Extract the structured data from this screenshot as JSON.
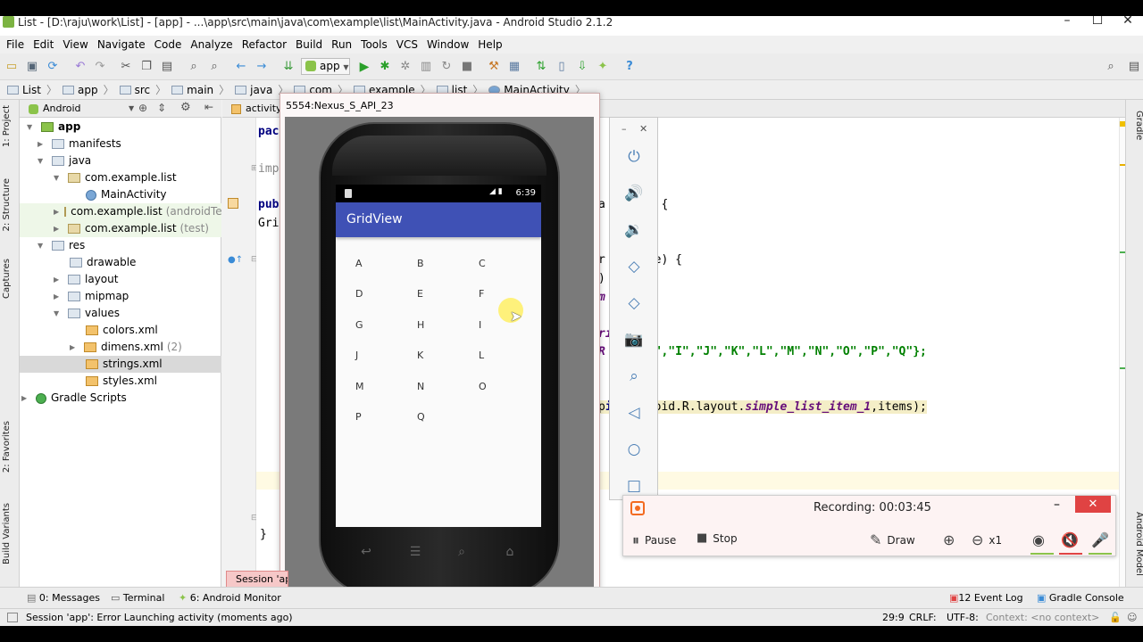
{
  "window": {
    "title": "List - [D:\\raju\\work\\List] - [app] - ...\\app\\src\\main\\java\\com\\example\\list\\MainActivity.java - Android Studio 2.1.2"
  },
  "menu": [
    "File",
    "Edit",
    "View",
    "Navigate",
    "Code",
    "Analyze",
    "Refactor",
    "Build",
    "Run",
    "Tools",
    "VCS",
    "Window",
    "Help"
  ],
  "toolbar": {
    "run_config": "app"
  },
  "breadcrumb": [
    "List",
    "app",
    "src",
    "main",
    "java",
    "com",
    "example",
    "list",
    "MainActivity"
  ],
  "left_tabs": [
    "1: Project",
    "2: Structure",
    "Captures",
    "2: Favorites",
    "Build Variants"
  ],
  "right_tabs": [
    "Gradle",
    "Android Model"
  ],
  "project_panel": {
    "view_selector": "Android",
    "tree": [
      {
        "label": "app",
        "extra": ""
      },
      {
        "label": "manifests",
        "extra": ""
      },
      {
        "label": "java",
        "extra": ""
      },
      {
        "label": "com.example.list",
        "extra": ""
      },
      {
        "label": "MainActivity",
        "extra": ""
      },
      {
        "label": "com.example.list",
        "extra": "(androidTest)"
      },
      {
        "label": "com.example.list",
        "extra": "(test)"
      },
      {
        "label": "res",
        "extra": ""
      },
      {
        "label": "drawable",
        "extra": ""
      },
      {
        "label": "layout",
        "extra": ""
      },
      {
        "label": "mipmap",
        "extra": ""
      },
      {
        "label": "values",
        "extra": ""
      },
      {
        "label": "colors.xml",
        "extra": ""
      },
      {
        "label": "dimens.xml",
        "extra": "(2)"
      },
      {
        "label": "strings.xml",
        "extra": ""
      },
      {
        "label": "styles.xml",
        "extra": ""
      },
      {
        "label": "Gradle Scripts",
        "extra": ""
      }
    ]
  },
  "editor": {
    "tab": "activity_",
    "lines": {
      "l1": "pac",
      "l2": "imp",
      "l3": "pub",
      "l4": "Gri",
      "l5a": "a",
      "l5b": "ivity {",
      "l6a": "r",
      "l6b": "eState) {",
      "l7": ")",
      "l8": "m",
      "l9a": "ri",
      "l9b": ";",
      "l10a": "R",
      "l10b": "\"G\",\"H\",\"I\",\"J\",\"K\",\"L\",\"M\",\"N\",\"O\",\"P\",\"Q\"};",
      "l11a": "p",
      "l11b": "is",
      "l11c": ",android.R.layout.",
      "l11d": "simple_list_item_1",
      "l11e": ",items);",
      "l12": "}"
    }
  },
  "emulator": {
    "title": "5554:Nexus_S_API_23",
    "time": "6:39",
    "app_title": "GridView",
    "grid": [
      "A",
      "B",
      "C",
      "D",
      "E",
      "F",
      "G",
      "H",
      "I",
      "J",
      "K",
      "L",
      "M",
      "N",
      "O",
      "P",
      "Q"
    ]
  },
  "recording": {
    "label": "Recording:",
    "time": "00:03:45",
    "pause": "Pause",
    "stop": "Stop",
    "draw": "Draw",
    "zoom": "x1"
  },
  "bottom_tabs": {
    "messages": "0: Messages",
    "terminal": "Terminal",
    "monitor": "6: Android Monitor",
    "event_log": "12 Event Log",
    "gradle_console": "Gradle Console"
  },
  "session_popup": "Session 'app'",
  "status": {
    "message": "Session 'app': Error Launching activity (moments ago)",
    "position": "29:9",
    "line_sep": "CRLF:",
    "encoding": "UTF-8:",
    "context": "Context: <no context>"
  }
}
